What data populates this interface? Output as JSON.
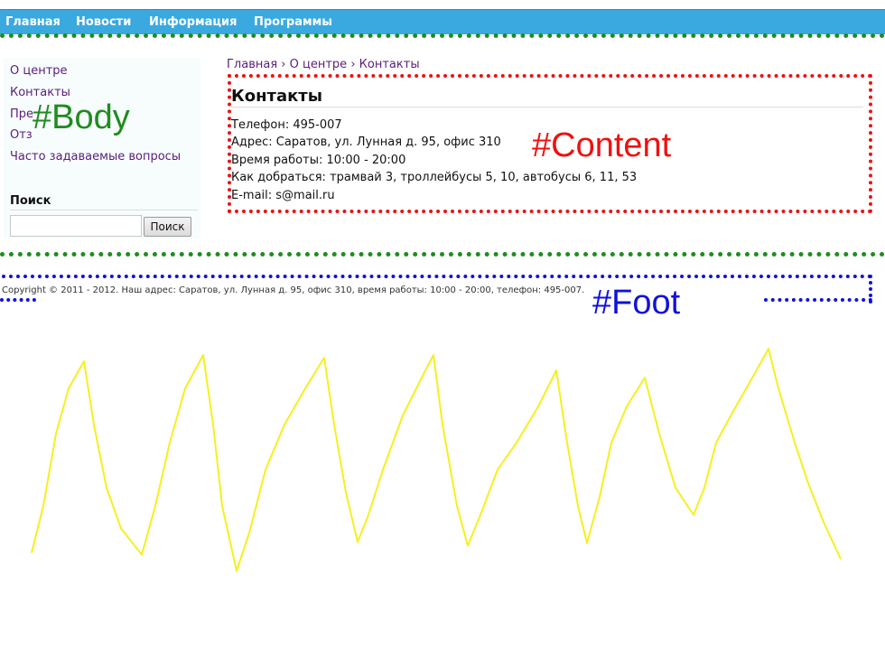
{
  "nav": {
    "items": [
      "Главная",
      "Новости",
      "Информация",
      "Программы"
    ]
  },
  "sidebar": {
    "links": [
      "О центре",
      "Контакты",
      "Пре",
      "Отз",
      "Часто задаваемые вопросы"
    ],
    "search_title": "Поиск",
    "search_value": "",
    "search_button": "Поиск"
  },
  "breadcrumb": {
    "items": [
      "Главная",
      "О центре",
      "Контакты"
    ],
    "separator": "›"
  },
  "content": {
    "title": "Контакты",
    "lines": [
      "Телефон: 495-007",
      "Адрес: Саратов, ул. Лунная д. 95, офис 310",
      "Время работы: 10:00 - 20:00",
      "Как добраться: трамвай 3, троллейбусы 5, 10, автобусы 6, 11, 53",
      "E-mail: s@mail.ru"
    ]
  },
  "footer": {
    "text": "Copyright © 2011 - 2012. Наш адрес: Саратов, ул. Лунная д. 95, офис 310, время работы: 10:00 - 20:00, телефон: 495-007."
  },
  "annotations": {
    "body_label": "#Body",
    "content_label": "#Content",
    "foot_label": "#Foot",
    "body_color": "#1f8c1f",
    "content_color": "#ee1111",
    "foot_color": "#1111dd",
    "scribble_color": "#f5f020"
  },
  "colors": {
    "nav_bg": "#3aa9e0",
    "link": "#5a1f7a"
  }
}
